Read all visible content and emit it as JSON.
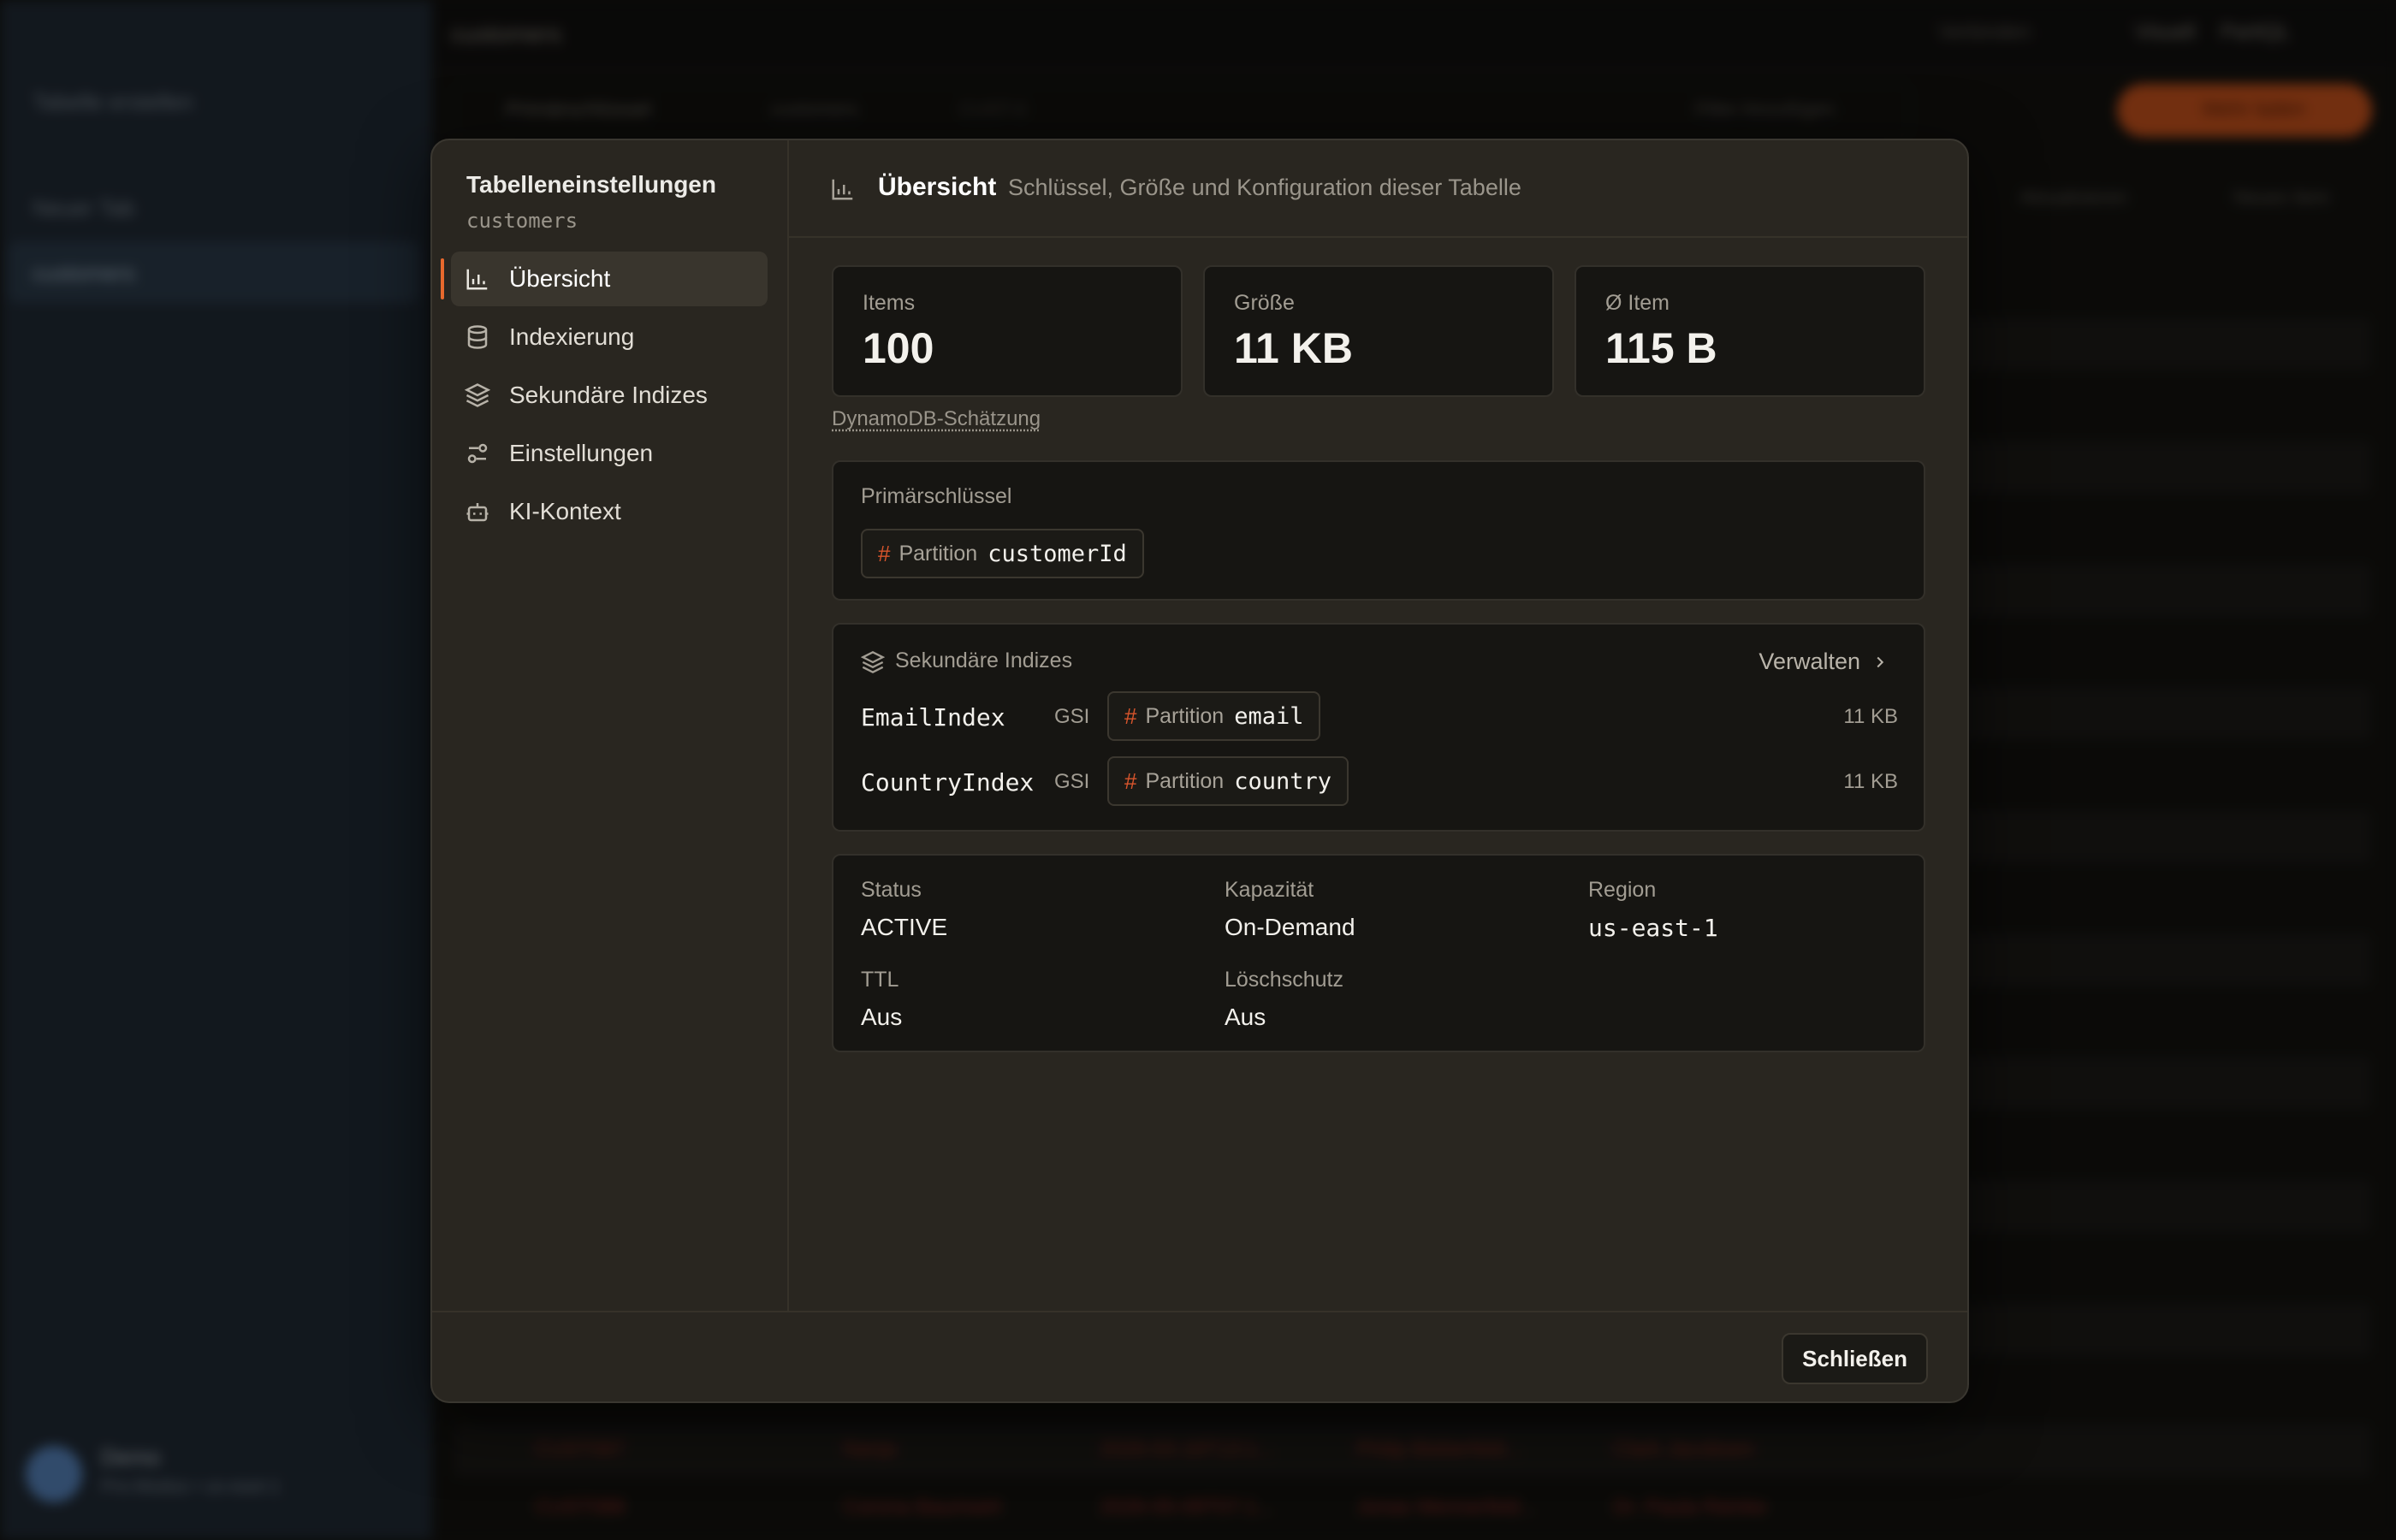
{
  "modal": {
    "title": "Tabelleneinstellungen",
    "table_name": "customers",
    "nav": [
      {
        "label": "Übersicht",
        "icon": "bar-chart-icon",
        "active": true
      },
      {
        "label": "Indexierung",
        "icon": "database-icon",
        "active": false
      },
      {
        "label": "Sekundäre Indizes",
        "icon": "layers-icon",
        "active": false
      },
      {
        "label": "Einstellungen",
        "icon": "sliders-icon",
        "active": false
      },
      {
        "label": "KI-Kontext",
        "icon": "bot-icon",
        "active": false
      }
    ],
    "header": {
      "title": "Übersicht",
      "description": "Schlüssel, Größe und Konfiguration dieser Tabelle"
    },
    "stats": [
      {
        "label": "Items",
        "value": "100"
      },
      {
        "label": "Größe",
        "value": "11 KB"
      },
      {
        "label": "Ø Item",
        "value": "115 B"
      }
    ],
    "estimate_link": "DynamoDB-Schätzung",
    "primary_key": {
      "label": "Primärschlüssel",
      "kind": "Partition",
      "name": "customerId"
    },
    "secondary_indexes": {
      "label": "Sekundäre Indizes",
      "manage_label": "Verwalten",
      "items": [
        {
          "name": "EmailIndex",
          "type": "GSI",
          "key_kind": "Partition",
          "key_name": "email",
          "size": "11 KB"
        },
        {
          "name": "CountryIndex",
          "type": "GSI",
          "key_kind": "Partition",
          "key_name": "country",
          "size": "11 KB"
        }
      ]
    },
    "details": [
      {
        "label": "Status",
        "value": "ACTIVE"
      },
      {
        "label": "Kapazität",
        "value": "On-Demand"
      },
      {
        "label": "Region",
        "value": "us-east-1"
      },
      {
        "label": "TTL",
        "value": "Aus"
      },
      {
        "label": "Löschschutz",
        "value": "Aus"
      }
    ],
    "close_label": "Schließen"
  },
  "background": {
    "sidebar": {
      "items": [
        "Tabelle erstellen",
        "Neuer Tab",
        "customers"
      ],
      "user_name": "Demo",
      "user_meta": "Pro-Modus • us-east-1"
    },
    "topbar": {
      "title": "customers",
      "right": [
        "Verbinden",
        "Visuell",
        "PartiQL"
      ]
    },
    "toolbar": {
      "key": "Primärschlüssel",
      "table": "customers",
      "pk": "CUST-0",
      "filter": "Filter hinzufügen",
      "scan": "Mehr laden"
    },
    "actions": [
      "Aktualisieren",
      "Neues Item"
    ],
    "rows": [
      {
        "id": "CUST087",
        "name": "Nanja",
        "date": "2026-03-18T13:1...",
        "company": "Philip Bieberfeld...",
        "contact": "Clark Jacobsen"
      },
      {
        "id": "CUST088",
        "name": "Corona Baumwirt",
        "date": "2026-05-09T07:1...",
        "company": "Jonas Mennerfeld...",
        "contact": "Dr. Paula Reinke"
      }
    ]
  }
}
